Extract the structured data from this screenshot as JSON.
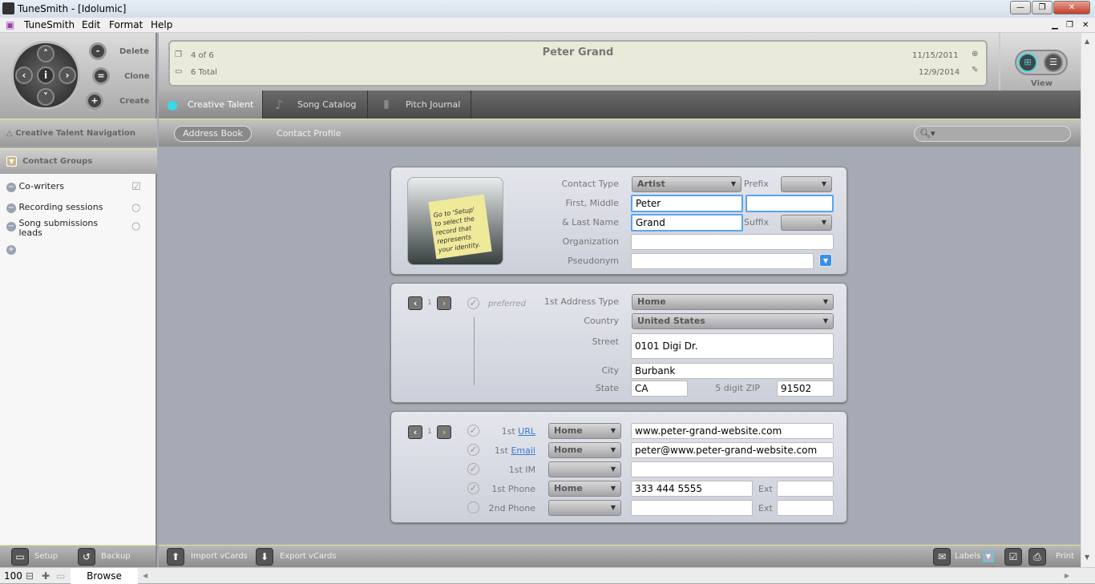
{
  "window": {
    "title": "TuneSmith - [Idolumic]"
  },
  "menu": [
    "TuneSmith",
    "Edit",
    "Format",
    "Help"
  ],
  "toolbar": {
    "delete": "Delete",
    "clone": "Clone",
    "create": "Create"
  },
  "record": {
    "position": "4 of 6",
    "total": "6 Total",
    "name": "Peter Grand",
    "created": "11/15/2011",
    "modified": "12/9/2014"
  },
  "view": {
    "label": "View",
    "active": "grid"
  },
  "tabs": [
    {
      "label": "Creative Talent",
      "active": true
    },
    {
      "label": "Song Catalog"
    },
    {
      "label": "Pitch Journal"
    }
  ],
  "sidebar": {
    "nav_title": "Creative Talent Navigation",
    "groups_title": "Contact Groups",
    "groups": [
      {
        "label": "Co-writers",
        "checked": true
      },
      {
        "label": "Recording sessions",
        "checked": false
      },
      {
        "label": "Song submissions leads",
        "checked": false
      }
    ]
  },
  "subnav": {
    "items": [
      "Address Book",
      "Contact Profile"
    ],
    "active": "Address Book"
  },
  "contact": {
    "photo_note": "Go to 'Setup' to select the record that represents your identity.",
    "contact_type_label": "Contact Type",
    "contact_type": "Artist",
    "prefix_label": "Prefix",
    "prefix": "",
    "first_middle_label": "First, Middle",
    "first": "Peter",
    "middle": "",
    "last_label": "& Last Name",
    "last": "Grand",
    "suffix_label": "Suffix",
    "suffix": "",
    "organization_label": "Organization",
    "organization": "",
    "pseudonym_label": "Pseudonym",
    "pseudonym": ""
  },
  "address": {
    "page": "1",
    "preferred": "preferred",
    "type_label": "1st Address Type",
    "type": "Home",
    "country_label": "Country",
    "country": "United States",
    "street_label": "Street",
    "street": "0101 Digi Dr.",
    "city_label": "City",
    "city": "Burbank",
    "state_label": "State",
    "state": "CA",
    "zip_label": "5 digit ZIP",
    "zip": "91502"
  },
  "comm": {
    "page": "1",
    "rows": [
      {
        "prefix": "1st",
        "label": "URL",
        "link": true,
        "type": "Home",
        "value": "www.peter-grand-website.com",
        "checked": true
      },
      {
        "prefix": "1st",
        "label": "Email",
        "link": true,
        "type": "Home",
        "value": "peter@www.peter-grand-website.com",
        "checked": true
      },
      {
        "prefix": "",
        "label": "1st IM",
        "link": false,
        "type": "",
        "value": "",
        "checked": true
      },
      {
        "prefix": "",
        "label": "1st Phone",
        "link": false,
        "type": "Home",
        "value": "333 444 5555",
        "checked": true,
        "ext_label": "Ext",
        "ext": ""
      },
      {
        "prefix": "",
        "label": "2nd Phone",
        "link": false,
        "type": "",
        "value": "",
        "checked": false,
        "ext_label": "Ext",
        "ext": ""
      }
    ]
  },
  "bottom": {
    "setup": "Setup",
    "backup": "Backup",
    "import": "Import vCards",
    "export": "Export vCards",
    "labels": "Labels",
    "print": "Print"
  },
  "status": {
    "zoom": "100",
    "mode": "Browse"
  },
  "colors": {
    "accent": "#3cd8e8",
    "focus": "#5aa4f0",
    "link": "#3a7ad8"
  }
}
